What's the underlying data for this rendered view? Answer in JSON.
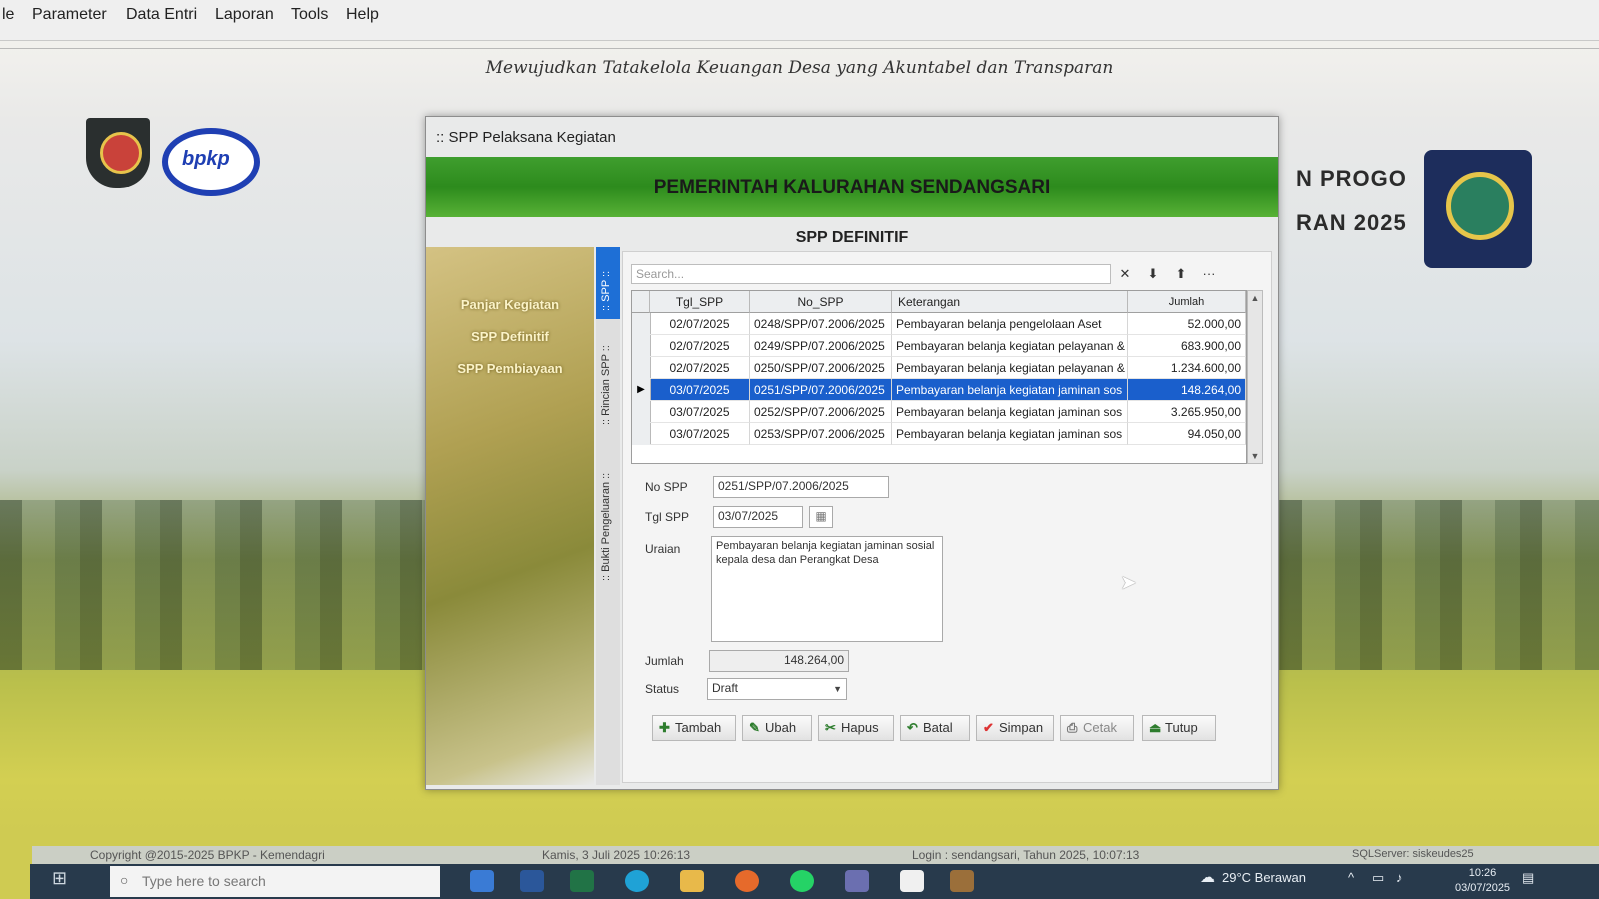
{
  "menu": {
    "items": [
      "le",
      "Parameter",
      "Data Entri",
      "Laporan",
      "Tools",
      "Help"
    ]
  },
  "header": {
    "motto": "Mewujudkan Tatakelola Keuangan Desa yang Akuntabel dan Transparan",
    "side_line1": "N PROGO",
    "side_line2": "RAN 2025",
    "bpkp_logo_text": "bpkp"
  },
  "window": {
    "title": ":: SPP Pelaksana Kegiatan",
    "banner": "PEMERINTAH KALURAHAN SENDANGSARI",
    "subtitle": "SPP DEFINITIF",
    "left_menu": [
      "Panjar Kegiatan",
      "SPP Definitif",
      "SPP Pembiayaan"
    ],
    "vtabs": [
      ":: SPP ::",
      ":: Rincian SPP ::",
      ":: Bukti Pengeluaran ::"
    ]
  },
  "grid": {
    "search_placeholder": "Search...",
    "toolbar_icons": [
      "close-icon",
      "arrow-down-icon",
      "arrow-up-icon",
      "more-icon"
    ],
    "columns": [
      "Tgl_SPP",
      "No_SPP",
      "Keterangan",
      "Jumlah"
    ],
    "rows": [
      {
        "tgl": "02/07/2025",
        "no": "0248/SPP/07.2006/2025",
        "ket": "Pembayaran belanja pengelolaan Aset",
        "jumlah": "52.000,00"
      },
      {
        "tgl": "02/07/2025",
        "no": "0249/SPP/07.2006/2025",
        "ket": "Pembayaran belanja kegiatan pelayanan &",
        "jumlah": "683.900,00"
      },
      {
        "tgl": "02/07/2025",
        "no": "0250/SPP/07.2006/2025",
        "ket": "Pembayaran belanja kegiatan pelayanan &",
        "jumlah": "1.234.600,00"
      },
      {
        "tgl": "03/07/2025",
        "no": "0251/SPP/07.2006/2025",
        "ket": "Pembayaran belanja kegiatan jaminan sos",
        "jumlah": "148.264,00"
      },
      {
        "tgl": "03/07/2025",
        "no": "0252/SPP/07.2006/2025",
        "ket": "Pembayaran belanja kegiatan jaminan sos",
        "jumlah": "3.265.950,00"
      },
      {
        "tgl": "03/07/2025",
        "no": "0253/SPP/07.2006/2025",
        "ket": "Pembayaran belanja kegiatan jaminan sos",
        "jumlah": "94.050,00"
      }
    ],
    "selected_row": 3
  },
  "form": {
    "no_spp_label": "No SPP",
    "no_spp_value": "0251/SPP/07.2006/2025",
    "tgl_spp_label": "Tgl SPP",
    "tgl_spp_value": "03/07/2025",
    "uraian_label": "Uraian",
    "uraian_value": "Pembayaran belanja kegiatan jaminan sosial kepala desa dan Perangkat Desa",
    "jumlah_label": "Jumlah",
    "jumlah_value": "148.264,00",
    "status_label": "Status",
    "status_value": "Draft"
  },
  "buttons": {
    "tambah": "Tambah",
    "ubah": "Ubah",
    "hapus": "Hapus",
    "batal": "Batal",
    "simpan": "Simpan",
    "cetak": "Cetak",
    "tutup": "Tutup"
  },
  "statusbar": {
    "copyright": "Copyright @2015-2025 BPKP - Kemendagri",
    "datetime": "Kamis, 3 Juli 2025  10:26:13",
    "login": "Login : sendangsari,  Tahun 2025, 10:07:13",
    "server": "SQLServer: siskeudes25"
  },
  "taskbar": {
    "search_placeholder": "Type here to search",
    "weather": "29°C  Berawan",
    "time": "10:26",
    "date": "03/07/2025"
  },
  "colors": {
    "banner_green": "#2d8b1d",
    "selection_blue": "#1a5fcc",
    "tab_active": "#1e6fd6"
  }
}
